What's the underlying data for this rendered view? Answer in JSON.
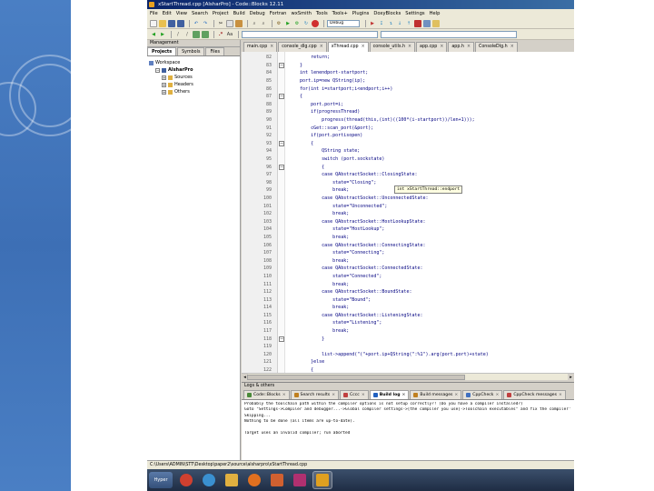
{
  "window": {
    "title": "xStartThread.cpp [AlsharPro] - Code::Blocks 12.11"
  },
  "menu": [
    "File",
    "Edit",
    "View",
    "Search",
    "Project",
    "Build",
    "Debug",
    "Fortran",
    "wxSmith",
    "Tools",
    "Tools+",
    "Plugins",
    "DoxyBlocks",
    "Settings",
    "Help"
  ],
  "toolbar": {
    "build_target": "Debug",
    "scope_combo": "",
    "symbol_combo": ""
  },
  "management": {
    "title": "Management",
    "tabs": [
      "Projects",
      "Symbols",
      "Files"
    ],
    "tree": [
      {
        "label": "Workspace",
        "level": 0,
        "type": "workspace"
      },
      {
        "label": "AlsharPro",
        "level": 1,
        "type": "project"
      },
      {
        "label": "Sources",
        "level": 2,
        "type": "folder"
      },
      {
        "label": "Headers",
        "level": 2,
        "type": "folder"
      },
      {
        "label": "Others",
        "level": 2,
        "type": "folder"
      }
    ]
  },
  "editor": {
    "tabs": [
      {
        "label": "main.cpp",
        "active": false
      },
      {
        "label": "console_dlg.cpp",
        "active": false
      },
      {
        "label": "xThread.cpp",
        "active": true
      },
      {
        "label": "console_utils.h",
        "active": false
      },
      {
        "label": "app.cpp",
        "active": false
      },
      {
        "label": "app.h",
        "active": false
      },
      {
        "label": "ConsoleDlg.h",
        "active": false
      }
    ],
    "lines": [
      {
        "n": "82",
        "code": "        return;"
      },
      {
        "n": "83",
        "code": "    }"
      },
      {
        "n": "84",
        "code": "    int lenendport-startport;"
      },
      {
        "n": "85",
        "code": "    port.ip=new QString(ip);"
      },
      {
        "n": "86",
        "code": "    for(int i=startport;i<endport;i++)"
      },
      {
        "n": "87",
        "code": "    {"
      },
      {
        "n": "88",
        "code": "        port.port=i;"
      },
      {
        "n": "89",
        "code": "        if(progressThread)"
      },
      {
        "n": "90",
        "code": "            progress(thread(this,(int)((100*(i-startport))/len+1)));"
      },
      {
        "n": "91",
        "code": "        cGet::scan_port(&port);"
      },
      {
        "n": "92",
        "code": "        if(port.portisopen)"
      },
      {
        "n": "93",
        "code": "        {"
      },
      {
        "n": "94",
        "code": "            QString state;"
      },
      {
        "n": "95",
        "code": "            switch (port.sockstate)"
      },
      {
        "n": "96",
        "code": "            {"
      },
      {
        "n": "97",
        "code": "            case QAbstractSocket::ClosingState:"
      },
      {
        "n": "98",
        "code": "                state=\"Closing\";"
      },
      {
        "n": "99",
        "code": "                break;"
      },
      {
        "n": "100",
        "code": "            case QAbstractSocket::UnconnectedState:"
      },
      {
        "n": "101",
        "code": "                state=\"Unconnected\";"
      },
      {
        "n": "102",
        "code": "                break;"
      },
      {
        "n": "103",
        "code": "            case QAbstractSocket::HostLookupState:"
      },
      {
        "n": "104",
        "code": "                state=\"HostLookup\";"
      },
      {
        "n": "105",
        "code": "                break;"
      },
      {
        "n": "106",
        "code": "            case QAbstractSocket::ConnectingState:"
      },
      {
        "n": "107",
        "code": "                state=\"Connecting\";"
      },
      {
        "n": "108",
        "code": "                break;"
      },
      {
        "n": "109",
        "code": "            case QAbstractSocket::ConnectedState:"
      },
      {
        "n": "110",
        "code": "                state=\"Connected\";"
      },
      {
        "n": "111",
        "code": "                break;"
      },
      {
        "n": "112",
        "code": "            case QAbstractSocket::BoundState:"
      },
      {
        "n": "113",
        "code": "                state=\"Bound\";"
      },
      {
        "n": "114",
        "code": "                break;"
      },
      {
        "n": "115",
        "code": "            case QAbstractSocket::ListeningState:"
      },
      {
        "n": "116",
        "code": "                state=\"Listening\";"
      },
      {
        "n": "117",
        "code": "                break;"
      },
      {
        "n": "118",
        "code": "            }"
      },
      {
        "n": "119",
        "code": ""
      },
      {
        "n": "120",
        "code": "            list->append(\"(\"+port.ip+QString(\":%1\").arg(port.port)+state)"
      },
      {
        "n": "121",
        "code": "        }else"
      },
      {
        "n": "122",
        "code": "        {"
      }
    ],
    "tooltip": "int xStartThread::endport"
  },
  "logs": {
    "title": "Logs & others",
    "tabs": [
      {
        "label": "Code::Blocks",
        "active": false,
        "color": "#4a8a3a"
      },
      {
        "label": "Search results",
        "active": false,
        "color": "#c08020"
      },
      {
        "label": "Cccc",
        "active": false,
        "color": "#c04040"
      },
      {
        "label": "Build log",
        "active": true,
        "color": "#2060c0"
      },
      {
        "label": "Build messages",
        "active": false,
        "color": "#c08020"
      },
      {
        "label": "CppCheck",
        "active": false,
        "color": "#4070c0"
      },
      {
        "label": "CppCheck messages",
        "active": false,
        "color": "#c04040"
      }
    ],
    "lines": [
      "Probably the toolchain path within the compiler options is not setup correctly?! (Do you have a compiler installed?)",
      "Goto \"Settings->Compiler and debugger...->Global compiler settings->[the compiler you use]->Toolchain executables\" and fix the compiler's setup.",
      "Skipping...",
      "Nothing to be done (all items are up-to-date).",
      "",
      "Target uses an invalid compiler; run aborted"
    ]
  },
  "status": {
    "path": "C:\\Users\\ADMIN\\STT\\Desktop\\paper2\\source\\alsharpro\\xStartThread.cpp"
  },
  "taskbar": {
    "start_label": "Hyper",
    "apps": [
      {
        "name": "chrome-icon",
        "color": "#d04030",
        "active": false
      },
      {
        "name": "ie-icon",
        "color": "#3a90d0",
        "active": false
      },
      {
        "name": "explorer-icon",
        "color": "#e0b040",
        "active": false
      },
      {
        "name": "firefox-icon",
        "color": "#e07020",
        "active": false
      },
      {
        "name": "office-icon",
        "color": "#d06030",
        "active": false
      },
      {
        "name": "paint-icon",
        "color": "#b03070",
        "active": false
      },
      {
        "name": "codeblocks-icon",
        "color": "#e0a020",
        "active": true
      }
    ]
  }
}
